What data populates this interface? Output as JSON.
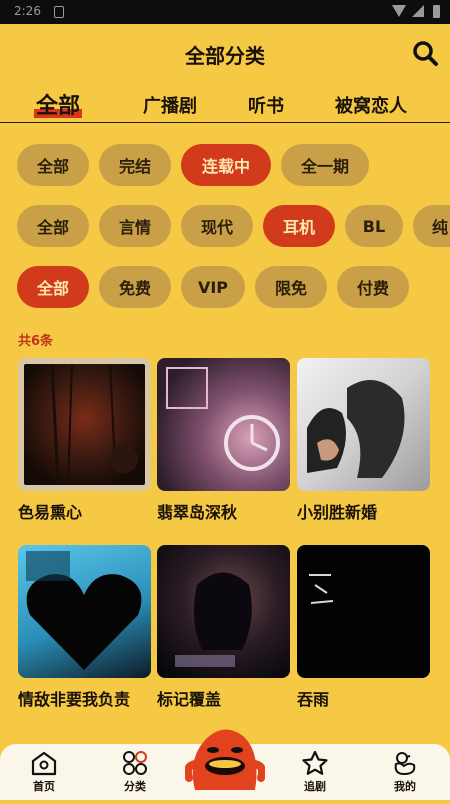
{
  "status_bar": {
    "time": "2:26"
  },
  "header": {
    "title": "全部分类",
    "search_icon": "search-icon"
  },
  "tabs": [
    {
      "label": "全部",
      "active": true
    },
    {
      "label": "广播剧",
      "active": false
    },
    {
      "label": "听书",
      "active": false
    },
    {
      "label": "被窝恋人",
      "active": false
    }
  ],
  "filters": {
    "status": [
      {
        "label": "全部",
        "active": false
      },
      {
        "label": "完结",
        "active": false
      },
      {
        "label": "连载中",
        "active": true
      },
      {
        "label": "全一期",
        "active": false
      }
    ],
    "genre": [
      {
        "label": "全部",
        "active": false
      },
      {
        "label": "言情",
        "active": false
      },
      {
        "label": "现代",
        "active": false
      },
      {
        "label": "耳机",
        "active": true
      },
      {
        "label": "BL",
        "active": false
      },
      {
        "label": "纯",
        "active": false
      }
    ],
    "price": [
      {
        "label": "全部",
        "active": true
      },
      {
        "label": "免费",
        "active": false
      },
      {
        "label": "VIP",
        "active": false
      },
      {
        "label": "限免",
        "active": false
      },
      {
        "label": "付费",
        "active": false
      }
    ]
  },
  "result_count": "共6条",
  "items": [
    {
      "title": "色易熏心"
    },
    {
      "title": "翡翠岛深秋"
    },
    {
      "title": "小别胜新婚"
    },
    {
      "title": "情敌非要我负责"
    },
    {
      "title": "标记覆盖"
    },
    {
      "title": "吞雨"
    }
  ],
  "bottom_nav": [
    {
      "label": "首页",
      "icon": "home-icon"
    },
    {
      "label": "分类",
      "icon": "category-icon"
    },
    {
      "label": "追剧",
      "icon": "star-icon"
    },
    {
      "label": "我的",
      "icon": "profile-icon"
    }
  ],
  "colors": {
    "background": "#f6c945",
    "accent": "#d13a1b",
    "chip": "#c9a048",
    "nav_bg": "#fbf6ea"
  }
}
